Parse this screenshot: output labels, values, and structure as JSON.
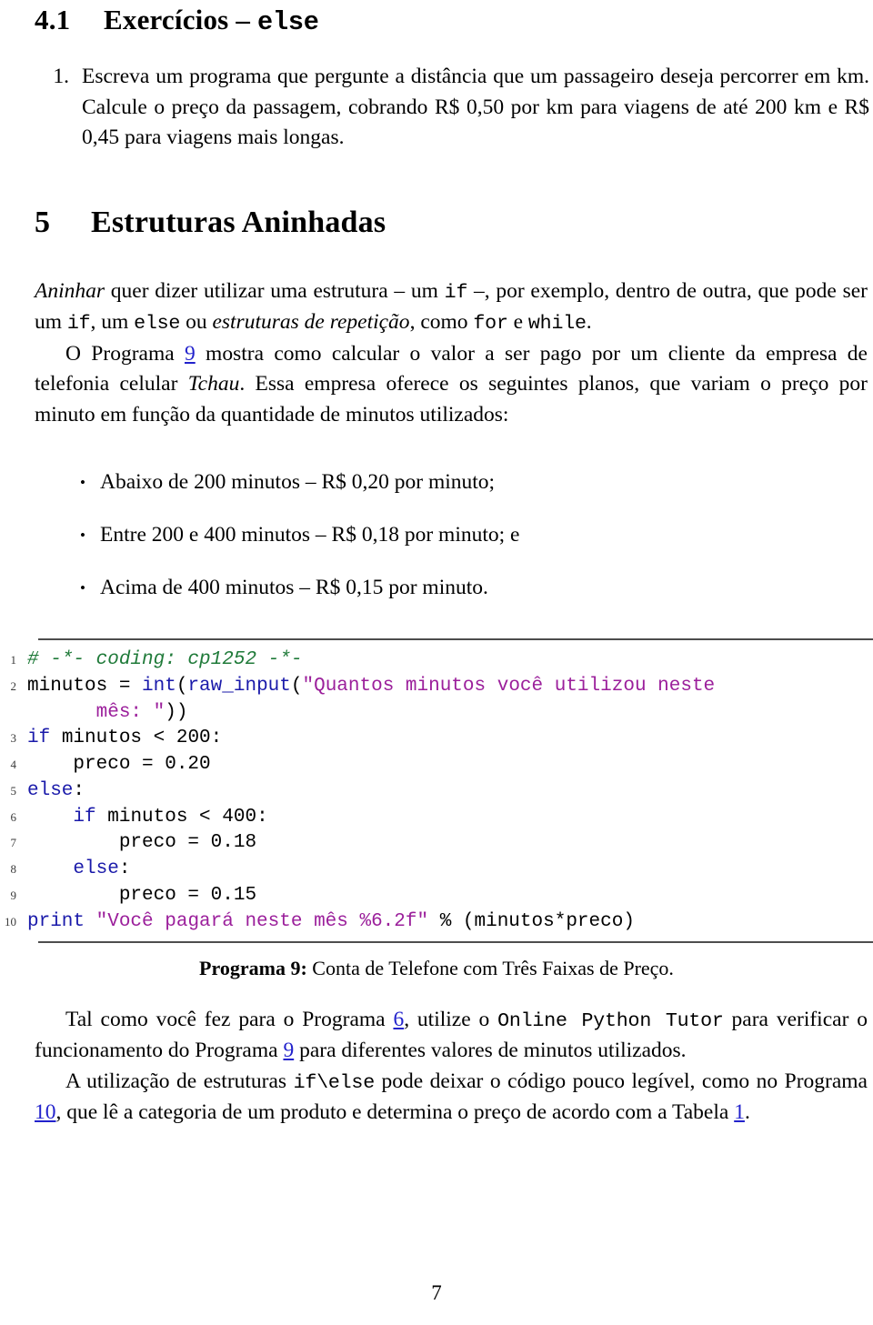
{
  "document": {
    "page_number": "7",
    "link_color": "#2222cc",
    "rule_color": "#4d4d4d"
  },
  "subsection": {
    "number": "4.1",
    "title_plain": "Exercícios – ",
    "title_mono": "else"
  },
  "exercises": [
    {
      "marker": "1.",
      "text": "Escreva um programa que pergunte a distância que um passageiro deseja percorrer em km. Calcule o preço da passagem, cobrando R$ 0,50 por km para viagens de até 200 km e R$ 0,45 para viagens mais longas."
    }
  ],
  "section": {
    "number": "5",
    "title": "Estruturas Aninhadas"
  },
  "intro_paragraph": {
    "p1_a": "Aninhar",
    "p1_b": " quer dizer utilizar uma estrutura – um ",
    "p1_c": "if",
    "p1_d": " –, por exemplo, dentro de outra, que pode ser um ",
    "p1_e": "if",
    "p1_f": ", um ",
    "p1_g": "else",
    "p1_h": " ou ",
    "p1_i": "estruturas de repetição",
    "p1_j": ", como ",
    "p1_k": "for",
    "p1_l": " e ",
    "p1_m": "while",
    "p1_n": "."
  },
  "program_paragraph": {
    "a": "O Programa ",
    "ref": "9",
    "b": " mostra como calcular o valor a ser pago por um cliente da empresa de telefonia celular ",
    "company": "Tchau",
    "c": ". Essa empresa oferece os seguintes planos, que variam o preço por minuto em função da quantidade de minutos utilizados:"
  },
  "plans": [
    {
      "bullet": "•",
      "text": "Abaixo de 200 minutos – R$ 0,20 por minuto;"
    },
    {
      "bullet": "•",
      "text": "Entre 200 e 400 minutos – R$ 0,18 por minuto; e"
    },
    {
      "bullet": "•",
      "text": "Acima de 400 minutos – R$ 0,15 por minuto."
    }
  ],
  "listing": {
    "language": "python",
    "lines": [
      {
        "number": "1",
        "tokens": [
          {
            "t": "c",
            "v": "# -*- coding: cp1252 -*-"
          }
        ]
      },
      {
        "number": "2",
        "tokens": [
          {
            "t": "n",
            "v": "minutos = "
          },
          {
            "t": "k",
            "v": "int"
          },
          {
            "t": "n",
            "v": "("
          },
          {
            "t": "k",
            "v": "raw_input"
          },
          {
            "t": "n",
            "v": "("
          },
          {
            "t": "s",
            "v": "\"Quantos minutos você utilizou neste"
          }
        ]
      },
      {
        "number": "",
        "tokens": [
          {
            "t": "n",
            "v": "      "
          },
          {
            "t": "s",
            "v": "mês: \""
          },
          {
            "t": "n",
            "v": "))"
          }
        ]
      },
      {
        "number": "3",
        "tokens": [
          {
            "t": "k",
            "v": "if"
          },
          {
            "t": "n",
            "v": " minutos < 200:"
          }
        ]
      },
      {
        "number": "4",
        "tokens": [
          {
            "t": "n",
            "v": "    preco = 0.20"
          }
        ]
      },
      {
        "number": "5",
        "tokens": [
          {
            "t": "k",
            "v": "else"
          },
          {
            "t": "n",
            "v": ":"
          }
        ]
      },
      {
        "number": "6",
        "tokens": [
          {
            "t": "n",
            "v": "    "
          },
          {
            "t": "k",
            "v": "if"
          },
          {
            "t": "n",
            "v": " minutos < 400:"
          }
        ]
      },
      {
        "number": "7",
        "tokens": [
          {
            "t": "n",
            "v": "        preco = 0.18"
          }
        ]
      },
      {
        "number": "8",
        "tokens": [
          {
            "t": "n",
            "v": "    "
          },
          {
            "t": "k",
            "v": "else"
          },
          {
            "t": "n",
            "v": ":"
          }
        ]
      },
      {
        "number": "9",
        "tokens": [
          {
            "t": "n",
            "v": "        preco = 0.15"
          }
        ]
      },
      {
        "number": "10",
        "tokens": [
          {
            "t": "k",
            "v": "print"
          },
          {
            "t": "n",
            "v": " "
          },
          {
            "t": "s",
            "v": "\"Você pagará neste mês %6.2f\""
          },
          {
            "t": "n",
            "v": " % (minutos*preco)"
          }
        ]
      }
    ]
  },
  "caption": {
    "label": "Programa 9:",
    "text": " Conta de Telefone com Três Faixas de Preço."
  },
  "tutor_paragraph": {
    "a": "Tal como você fez para o Programa ",
    "ref1": "6",
    "b": ", utilize o ",
    "tool": "Online Python Tutor",
    "c": " para verificar o funcionamento do Programa ",
    "ref2": "9",
    "d": " para diferentes valores de minutos utilizados."
  },
  "legibility_paragraph": {
    "a": "A utilização de estruturas ",
    "code": "if\\else",
    "b": " pode deixar o código pouco legível, como no Programa ",
    "ref1": "10",
    "c": ", que lê a categoria de um produto e determina o preço de acordo com a Tabela ",
    "ref2": "1",
    "d": "."
  }
}
